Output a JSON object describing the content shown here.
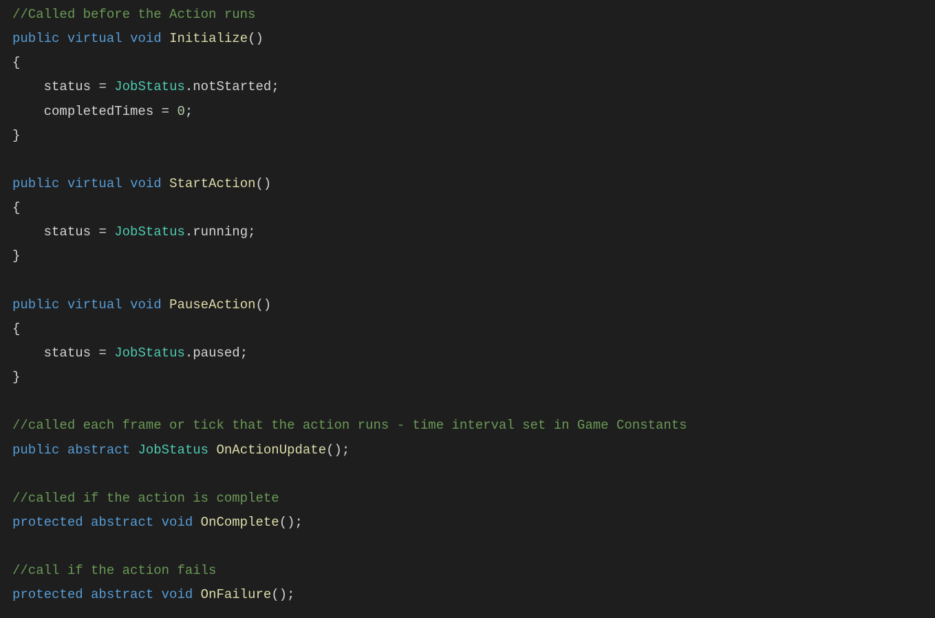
{
  "line1_comment": "//Called before the Action runs",
  "kw_public": "public",
  "kw_virtual": "virtual",
  "kw_void": "void",
  "kw_abstract": "abstract",
  "kw_protected": "protected",
  "m_initialize": "Initialize",
  "m_startaction": "StartAction",
  "m_pauseaction": "PauseAction",
  "m_onactionupdate": "OnActionUpdate",
  "m_oncomplete": "OnComplete",
  "m_onfailure": "OnFailure",
  "id_status": "status",
  "id_completed": "completedTimes",
  "id_jobstatus": "JobStatus",
  "en_notstarted": "notStarted",
  "en_running": "running",
  "en_paused": "paused",
  "num_zero": "0",
  "comment_tick": "//called each frame or tick that the action runs - time interval set in Game Constants",
  "comment_complete": "//called if the action is complete",
  "comment_fail": "//call if the action fails"
}
